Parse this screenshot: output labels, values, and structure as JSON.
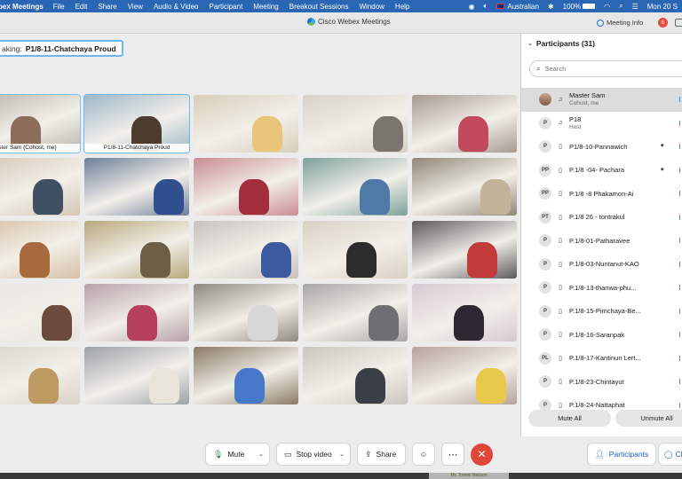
{
  "menubar": {
    "app_name": "bex Meetings",
    "menus": [
      "File",
      "Edit",
      "Share",
      "View",
      "Audio & Video",
      "Participant",
      "Meeting",
      "Breakout Sessions",
      "Window",
      "Help"
    ],
    "input_source": "Australian",
    "battery": "100%",
    "clock": "Mon 20 S"
  },
  "window": {
    "title": "Cisco Webex Meetings",
    "meeting_info": "Meeting Info",
    "notification_count": "6"
  },
  "speaking": {
    "label": "aking:",
    "name": "P1/8-11-Chatchaya Proud"
  },
  "grid": {
    "tiles": [
      {
        "caption": "ster Sam  (Cohost, me)",
        "scene": "#b9b3ad",
        "accent": "#8b6d5a"
      },
      {
        "caption": "P1/8-11-Chatchaya Proud",
        "scene": "#9fb7c9",
        "accent": "#4d3b2e"
      },
      {
        "caption": "",
        "scene": "#d8cdb9",
        "accent": "#e9c57a"
      },
      {
        "caption": "",
        "scene": "#d7d2c9",
        "accent": "#7b7570"
      },
      {
        "caption": "",
        "scene": "#a79a91",
        "accent": "#c24a5c"
      },
      {
        "caption": "",
        "scene": "#d4c6b5",
        "accent": "#3e5062"
      },
      {
        "caption": "",
        "scene": "#6d7f99",
        "accent": "#2f4f8e"
      },
      {
        "caption": "",
        "scene": "#c98d93",
        "accent": "#a22d3b"
      },
      {
        "caption": "",
        "scene": "#7ea19a",
        "accent": "#4f7aa8"
      },
      {
        "caption": "",
        "scene": "#8f8676",
        "accent": "#c3b39a"
      },
      {
        "caption": "",
        "scene": "#d6c0a6",
        "accent": "#a66a3c"
      },
      {
        "caption": "",
        "scene": "#b9a87c",
        "accent": "#6c5f45"
      },
      {
        "caption": "",
        "scene": "#c8c2bd",
        "accent": "#3d5aa1"
      },
      {
        "caption": "",
        "scene": "#d9d0c4",
        "accent": "#2c2c2c"
      },
      {
        "caption": "",
        "scene": "#5c5a5c",
        "accent": "#c23b3b"
      },
      {
        "caption": "",
        "scene": "#e7e3df",
        "accent": "#6b4b3c"
      },
      {
        "caption": "",
        "scene": "#b8a1a6",
        "accent": "#b53f5c"
      },
      {
        "caption": "",
        "scene": "#8e8a7f",
        "accent": "#d7d7d7"
      },
      {
        "caption": "",
        "scene": "#a8a6a4",
        "accent": "#6f6e72"
      },
      {
        "caption": "",
        "scene": "#d9c9d2",
        "accent": "#2c2730"
      },
      {
        "caption": "",
        "scene": "#d9d3c8",
        "accent": "#bd9b60"
      },
      {
        "caption": "",
        "scene": "#9ca2a8",
        "accent": "#e9e4da"
      },
      {
        "caption": "",
        "scene": "#8a7a66",
        "accent": "#4677c8"
      },
      {
        "caption": "",
        "scene": "#c9c7c0",
        "accent": "#3a3f45"
      },
      {
        "caption": "",
        "scene": "#b7a29b",
        "accent": "#e8c84a"
      }
    ]
  },
  "controls": {
    "mute": "Mute",
    "stop_video": "Stop video",
    "share": "Share",
    "participants": "Participants",
    "chat": "Ch"
  },
  "panel": {
    "title": "Participants (31)",
    "search_placeholder": "Search",
    "mute_all": "Mute All",
    "unmute_all": "Unmute All",
    "participants": [
      {
        "initials": "",
        "name": "Master Sam",
        "sub": "Cohost, me",
        "photo": true
      },
      {
        "initials": "P",
        "name": "P18",
        "sub": "Host"
      },
      {
        "initials": "P",
        "name": "P1/8-10-Pannawich",
        "sub": "",
        "extra": "⏺"
      },
      {
        "initials": "PP",
        "name": "P.1/8 -04- Pachara",
        "sub": "",
        "extra": "⏺"
      },
      {
        "initials": "PP",
        "name": "P.1/8 -8 Phakamon-Ai",
        "sub": ""
      },
      {
        "initials": "PT",
        "name": "P.1/8 26 - tontrakul",
        "sub": ""
      },
      {
        "initials": "P",
        "name": "P.1/8-01-Patharavee",
        "sub": ""
      },
      {
        "initials": "P",
        "name": "P.1/8-03-Nuntanut-KAO",
        "sub": ""
      },
      {
        "initials": "P",
        "name": "P.1/8-13-thanwa-phu...",
        "sub": ""
      },
      {
        "initials": "P",
        "name": "P.1/8-15-Pimchaya-Be...",
        "sub": ""
      },
      {
        "initials": "P",
        "name": "P.1/8-16-Saranpak",
        "sub": ""
      },
      {
        "initials": "PL",
        "name": "P.1/8-17-Kantinun Lert...",
        "sub": ""
      },
      {
        "initials": "P",
        "name": "P.1/8-23-Chintayut",
        "sub": ""
      },
      {
        "initials": "P",
        "name": "P.1/8-24-Nattaphat",
        "sub": ""
      }
    ]
  },
  "taskbar_chip": "Mr. Tommi Neilson"
}
